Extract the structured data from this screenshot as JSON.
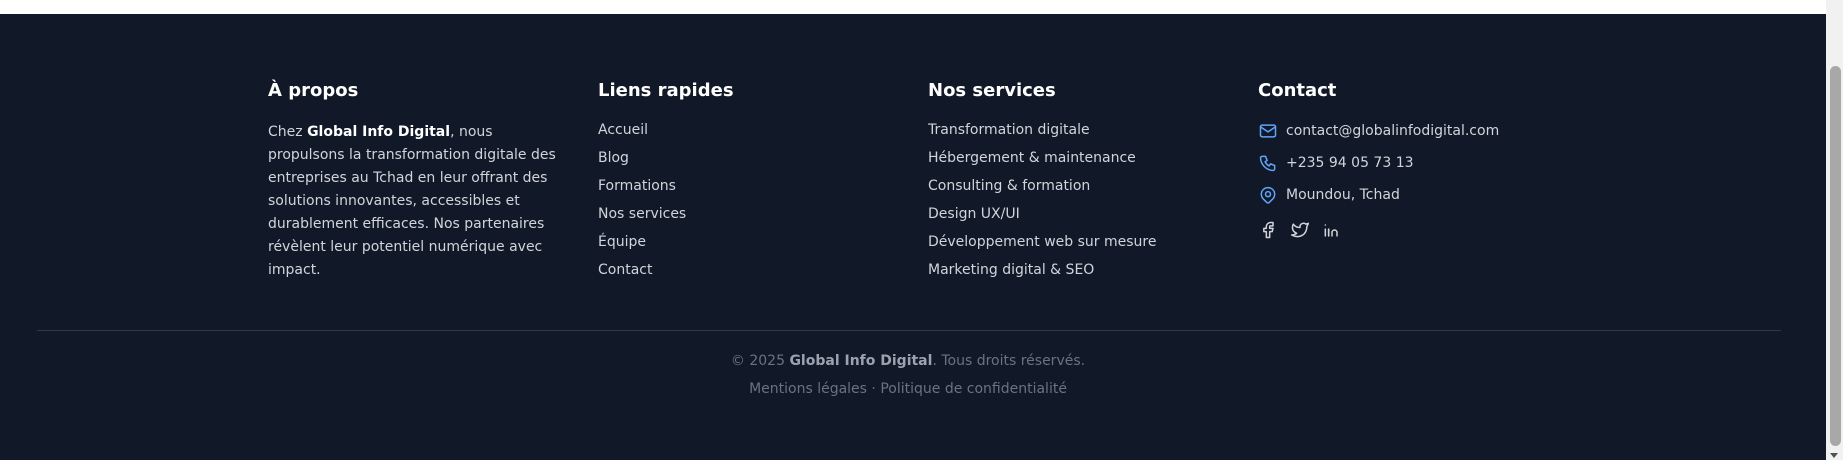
{
  "about": {
    "heading": "À propos",
    "text_before": "Chez ",
    "brand": "Global Info Digital",
    "text_after": ", nous propulsons la transformation digitale des entreprises au Tchad en leur offrant des solutions innovantes, accessibles et durablement efficaces. Nos partenaires révèlent leur potentiel numérique avec impact."
  },
  "quick_links": {
    "heading": "Liens rapides",
    "items": [
      "Accueil",
      "Blog",
      "Formations",
      "Nos services",
      "Équipe",
      "Contact"
    ]
  },
  "services": {
    "heading": "Nos services",
    "items": [
      "Transformation digitale",
      "Hébergement & maintenance",
      "Consulting & formation",
      "Design UX/UI",
      "Développement web sur mesure",
      "Marketing digital & SEO"
    ]
  },
  "contact": {
    "heading": "Contact",
    "email": "contact@globalinfodigital.com",
    "phone": "+235 94 05 73 13",
    "location": "Moundou, Tchad",
    "icon_color": "#60a5fa",
    "social": [
      "facebook-icon",
      "twitter-icon",
      "linkedin-icon"
    ]
  },
  "bottom": {
    "copyright_prefix": "© 2025 ",
    "brand": "Global Info Digital",
    "copyright_suffix": ". Tous droits réservés.",
    "legal": "Mentions légales",
    "separator": " · ",
    "privacy": "Politique de confidentialité"
  },
  "colors": {
    "background": "#111827",
    "heading": "#ffffff",
    "text": "#d1d5db",
    "muted": "#6b7280",
    "accent": "#60a5fa"
  }
}
